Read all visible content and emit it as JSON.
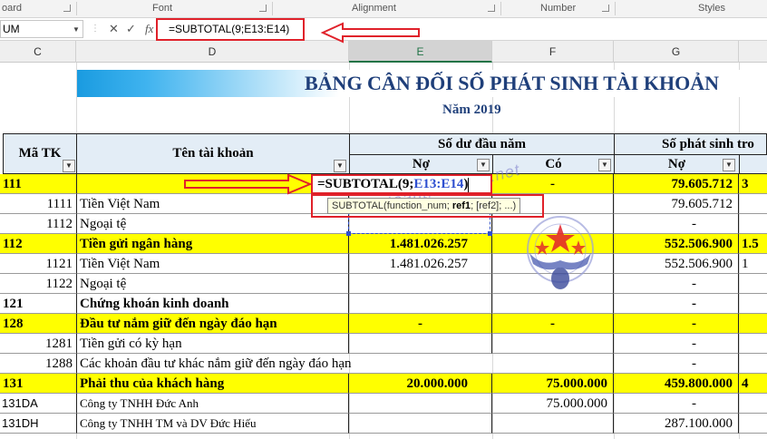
{
  "ribbon": {
    "groups": [
      "oard",
      "Font",
      "Alignment",
      "Number",
      "Styles"
    ]
  },
  "formula_bar": {
    "name_box": "UM",
    "fx_label": "fx",
    "formula": "=SUBTOTAL(9;E13:E14)"
  },
  "columns": [
    "C",
    "D",
    "E",
    "F",
    "G"
  ],
  "sheet": {
    "title": "BẢNG CÂN ĐỐI SỐ PHÁT SINH TÀI KHOẢN",
    "year": "Năm 2019",
    "headers": {
      "ma_tk": "Mã TK",
      "ten_tk": "Tên tài khoản",
      "so_du_dau_nam": "Số dư đầu năm",
      "so_phat_sinh": "Số phát sinh tro",
      "no": "Nợ",
      "co": "Có",
      "no2": "Nợ"
    },
    "rows": [
      {
        "code": "111",
        "name": "",
        "e": "",
        "f": "-",
        "g": "79.605.712",
        "h": "3"
      },
      {
        "code": "1111",
        "name": "Tiền Việt Nam",
        "e": "",
        "f": "",
        "g": "79.605.712",
        "h": ""
      },
      {
        "code": "1112",
        "name": "Ngoại tệ",
        "e": "",
        "f": "",
        "g": "-",
        "h": ""
      },
      {
        "code": "112",
        "name": "Tiền gửi ngân hàng",
        "e": "1.481.026.257",
        "f": "",
        "g": "552.506.900",
        "h": "1.5"
      },
      {
        "code": "1121",
        "name": "Tiền Việt Nam",
        "e": "1.481.026.257",
        "f": "",
        "g": "552.506.900",
        "h": "1"
      },
      {
        "code": "1122",
        "name": "Ngoại tệ",
        "e": "",
        "f": "",
        "g": "-",
        "h": ""
      },
      {
        "code": "121",
        "name": "Chứng khoán kinh doanh",
        "e": "",
        "f": "",
        "g": "-",
        "h": ""
      },
      {
        "code": "128",
        "name": "Đầu tư nắm giữ đến ngày đáo hạn",
        "e": "-",
        "f": "-",
        "g": "-",
        "h": ""
      },
      {
        "code": "1281",
        "name": "Tiền gửi có kỳ hạn",
        "e": "",
        "f": "",
        "g": "-",
        "h": ""
      },
      {
        "code": "1288",
        "name": "Các khoản đầu tư khác nắm giữ đến ngày đáo hạn",
        "e": "",
        "f": "",
        "g": "-",
        "h": ""
      },
      {
        "code": "131",
        "name": "Phải thu của khách hàng",
        "e": "20.000.000",
        "f": "75.000.000",
        "g": "459.800.000",
        "h": "4"
      },
      {
        "code": "131DA",
        "name": "Công ty TNHH Đức Anh",
        "e": "",
        "f": "75.000.000",
        "g": "-",
        "h": ""
      },
      {
        "code": "131DH",
        "name": "Công ty TNHH TM và DV Đức Hiếu",
        "e": "",
        "f": "",
        "g": "287.100.000",
        "h": ""
      }
    ]
  },
  "editing": {
    "prefix": "=SUBTOTAL(9;",
    "ref": "E13:E14",
    "suffix": ")",
    "tooltip_func": "SUBTOTAL(function_num; ",
    "tooltip_ref1": "ref1",
    "tooltip_rest": "; [ref2]; ...)"
  },
  "watermark": "Ketoanthienung.net",
  "colors": {
    "highlight": "#ffff00",
    "annotation_red": "#e0212a",
    "title_blue": "#1f3f7a",
    "header_fill": "#e3edf6"
  }
}
